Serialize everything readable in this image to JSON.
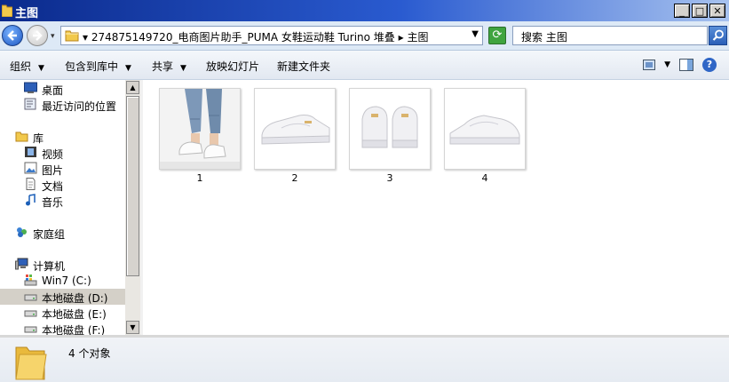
{
  "window": {
    "title": "主图"
  },
  "address": {
    "path": "▾ 274875149720_电商图片助手_PUMA 女鞋运动鞋 Turino 堆叠 ▸ 主图",
    "search_placeholder": "搜索 主图"
  },
  "toolbar": {
    "organize": "组织",
    "include_in_library": "包含到库中",
    "share": "共享",
    "slideshow": "放映幻灯片",
    "new_folder": "新建文件夹"
  },
  "sidebar": {
    "items": [
      {
        "label": "桌面",
        "icon": "desktop-icon"
      },
      {
        "label": "最近访问的位置",
        "icon": "recent-places-icon"
      },
      {
        "label": "库",
        "icon": "library-icon"
      },
      {
        "label": "视频",
        "icon": "video-icon"
      },
      {
        "label": "图片",
        "icon": "pictures-icon"
      },
      {
        "label": "文档",
        "icon": "documents-icon"
      },
      {
        "label": "音乐",
        "icon": "music-icon"
      },
      {
        "label": "家庭组",
        "icon": "homegroup-icon"
      },
      {
        "label": "计算机",
        "icon": "computer-icon"
      },
      {
        "label": "Win7 (C:)",
        "icon": "system-drive-icon"
      },
      {
        "label": "本地磁盘 (D:)",
        "icon": "drive-icon",
        "selected": true
      },
      {
        "label": "本地磁盘 (E:)",
        "icon": "drive-icon"
      },
      {
        "label": "本地磁盘 (F:)",
        "icon": "drive-icon"
      }
    ]
  },
  "files": [
    {
      "name": "1"
    },
    {
      "name": "2"
    },
    {
      "name": "3"
    },
    {
      "name": "4"
    }
  ],
  "status": {
    "count_text": "4 个对象"
  },
  "colors": {
    "titlebar": "#0b2a8c",
    "selection": "#d4d0c8",
    "addrbar": "#dde9f6"
  }
}
